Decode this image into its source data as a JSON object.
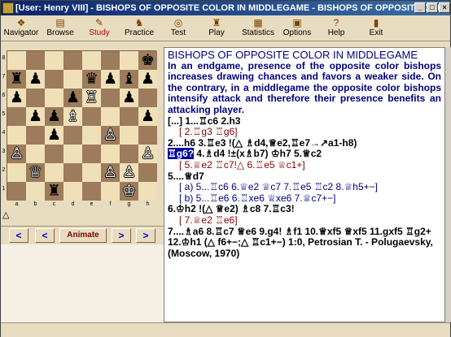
{
  "window": {
    "title": "[User: Henry VIII] - BISHOPS OF OPPOSITE COLOR IN MIDDLEGAME - BISHOPS OF OPPOSITE COLOR IN MIDDLEGAME -",
    "min": "_",
    "max": "□",
    "close": "×"
  },
  "toolbar": [
    {
      "id": "navigator",
      "label": "Navigator",
      "icon": "navigator-icon",
      "glyph": "❖"
    },
    {
      "id": "browse",
      "label": "Browse",
      "icon": "book-icon",
      "glyph": "▤"
    },
    {
      "id": "study",
      "label": "Study",
      "icon": "study-icon",
      "glyph": "✎",
      "selected": true
    },
    {
      "id": "practice",
      "label": "Practice",
      "icon": "practice-icon",
      "glyph": "♞"
    },
    {
      "id": "test",
      "label": "Test",
      "icon": "test-icon",
      "glyph": "◎"
    },
    {
      "id": "play",
      "label": "Play",
      "icon": "play-icon",
      "glyph": "♜"
    },
    {
      "id": "statistics",
      "label": "Statistics",
      "icon": "statistics-icon",
      "glyph": "▦"
    },
    {
      "id": "options",
      "label": "Options",
      "icon": "options-icon",
      "glyph": "▣"
    },
    {
      "id": "help",
      "label": "Help",
      "icon": "help-icon",
      "glyph": "?"
    },
    {
      "id": "exit",
      "label": "Exit",
      "icon": "exit-icon",
      "glyph": "▮"
    }
  ],
  "board": {
    "ranks": [
      "8",
      "7",
      "6",
      "5",
      "4",
      "3",
      "2",
      "1"
    ],
    "files": [
      "a",
      "b",
      "c",
      "d",
      "e",
      "f",
      "g",
      "h"
    ],
    "pieces": [
      {
        "sq": "h8",
        "p": "♚",
        "c": "b"
      },
      {
        "sq": "a7",
        "p": "♜",
        "c": "b"
      },
      {
        "sq": "b7",
        "p": "♟",
        "c": "b"
      },
      {
        "sq": "e7",
        "p": "♛",
        "c": "b"
      },
      {
        "sq": "f7",
        "p": "♟",
        "c": "b"
      },
      {
        "sq": "g7",
        "p": "♝",
        "c": "b"
      },
      {
        "sq": "h7",
        "p": "♟",
        "c": "b"
      },
      {
        "sq": "a6",
        "p": "♟",
        "c": "b"
      },
      {
        "sq": "d6",
        "p": "♟",
        "c": "b"
      },
      {
        "sq": "e6",
        "p": "♖",
        "c": "w"
      },
      {
        "sq": "g6",
        "p": "♟",
        "c": "b"
      },
      {
        "sq": "b5",
        "p": "♟",
        "c": "b"
      },
      {
        "sq": "c5",
        "p": "♟",
        "c": "b"
      },
      {
        "sq": "d5",
        "p": "♗",
        "c": "w"
      },
      {
        "sq": "h5",
        "p": "♟",
        "c": "b"
      },
      {
        "sq": "c4",
        "p": "♟",
        "c": "b"
      },
      {
        "sq": "f4",
        "p": "♙",
        "c": "w"
      },
      {
        "sq": "a3",
        "p": "♙",
        "c": "w"
      },
      {
        "sq": "h3",
        "p": "♙",
        "c": "w"
      },
      {
        "sq": "b2",
        "p": "♕",
        "c": "w"
      },
      {
        "sq": "f2",
        "p": "♙",
        "c": "w"
      },
      {
        "sq": "g2",
        "p": "♙",
        "c": "w"
      },
      {
        "sq": "c1",
        "p": "♜",
        "c": "b"
      },
      {
        "sq": "g1",
        "p": "♔",
        "c": "w"
      }
    ]
  },
  "side_to_move": "△",
  "nav": {
    "first": "<",
    "prev": "<",
    "animate": "Animate",
    "next": ">",
    "last": ">"
  },
  "text": {
    "title": "BISHOPS OF OPPOSITE COLOR IN MIDDLEGAME",
    "intro": "In an endgame, presence of the opposite color bishops increases drawing chances and favors a weaker side. On the contrary, in a middlegame the opposite color bishops intensify attack and therefore their presence benefits an attacking player.",
    "l1": "[...] 1...♖c6 2.h3",
    "l2": "[ 2.♖g3 ♖g6]",
    "l3": "2....h6    3.♖e3 !(△ ♗d4,♕e2,♖e7→↗a1-h8)",
    "l4a": "♖g6?",
    "l4b": " 4.♗d4 !±(x♗b7) ♔h7 5.♕c2",
    "l5": "[ 5.♕e2 ♖c7!△ 6.♖e5 ♕c1+]",
    "l6": "5....♕d7",
    "l7": "[ a) 5...♖c6 6.♕e2 ♕c7 7.♖e5 ♖c2 8.♕h5+−]",
    "l8": "[ b) 5...♖e6 6.♖xe6 ♕xe6 7.♕c7+−]",
    "l9": "6.♔h2 !(△ ♕e2) ♗c8 7.♖c3!",
    "l10": "[ 7.♕e2 ♖e6]",
    "l11": "7....♗a6 8.♖c7 ♕e6 9.g4! ♗f1 10.♕xf5 ♕xf5 11.gxf5 ♖g2+ 12.♔h1 (△ f6+−;△ ♖c1+−) 1:0, Petrosian T. - Polugaevsky, (Moscow, 1970)"
  }
}
